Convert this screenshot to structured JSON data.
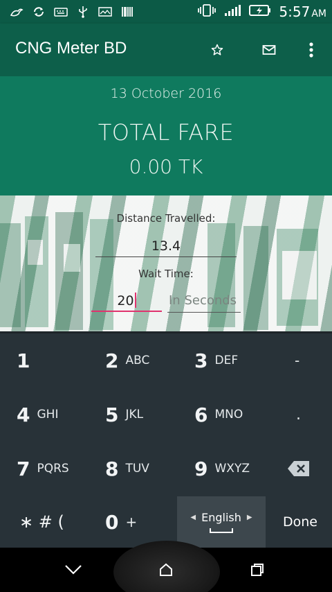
{
  "status_bar": {
    "time": "5:57",
    "ampm": "AM",
    "icons": [
      "bird-notification-icon",
      "sync-icon",
      "keyboard-icon",
      "usb-icon",
      "image-icon",
      "barcode-icon",
      "vibrate-icon",
      "signal-icon",
      "battery-charging-icon"
    ]
  },
  "app_bar": {
    "title": "CNG Meter BD",
    "actions": [
      "star-icon",
      "mail-icon",
      "overflow-menu-icon"
    ]
  },
  "fare": {
    "date": "13 October 2016",
    "label": "TOTAL FARE",
    "value": "0.00 TK"
  },
  "form": {
    "distance_label": "Distance Travelled:",
    "distance_value": "13.4",
    "wait_label": "Wait Time:",
    "wait_value": "20",
    "wait_unit_placeholder": "In Seconds"
  },
  "keyboard": {
    "rows": [
      [
        {
          "num": "1",
          "sub": ""
        },
        {
          "num": "2",
          "sub": "ABC"
        },
        {
          "num": "3",
          "sub": "DEF"
        },
        {
          "num": "-",
          "sub": ""
        }
      ],
      [
        {
          "num": "4",
          "sub": "GHI"
        },
        {
          "num": "5",
          "sub": "JKL"
        },
        {
          "num": "6",
          "sub": "MNO"
        },
        {
          "num": ".",
          "sub": ""
        }
      ],
      [
        {
          "num": "7",
          "sub": "PQRS"
        },
        {
          "num": "8",
          "sub": "TUV"
        },
        {
          "num": "9",
          "sub": "WXYZ"
        }
      ],
      [
        {
          "num": "∗ # (",
          "sub": ""
        },
        {
          "num": "0",
          "sub": "+"
        }
      ]
    ],
    "language": "English",
    "done_label": "Done"
  },
  "colors": {
    "status_bar": "#0c5a46",
    "app_bar": "#0d5f4a",
    "fare_panel": "#0f7a5e",
    "accent": "#e0336e",
    "keyboard_bg": "#283238"
  }
}
